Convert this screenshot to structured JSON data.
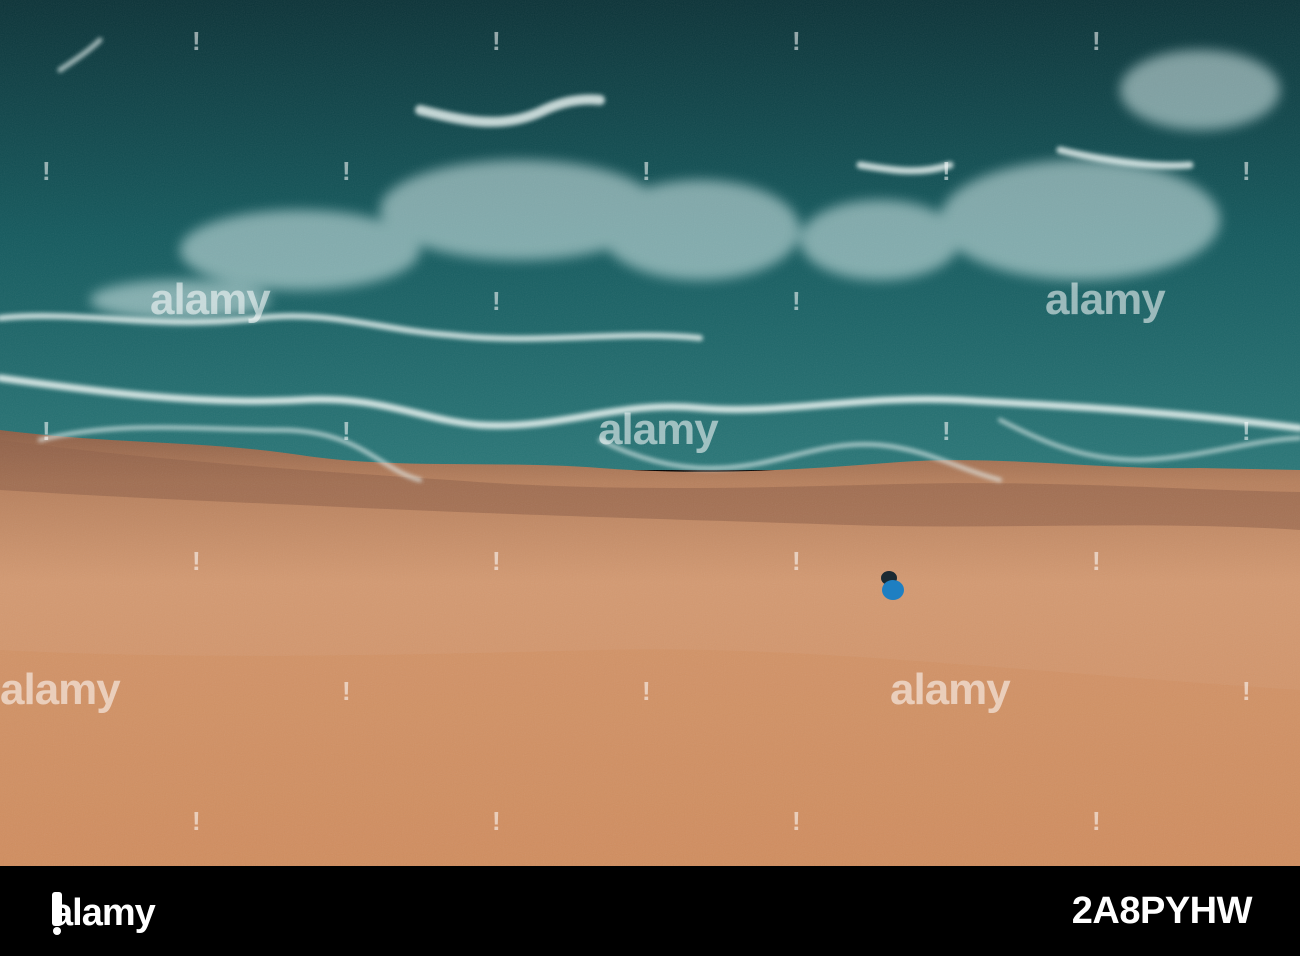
{
  "watermark": {
    "brand": "alamy",
    "mark": "!"
  },
  "footer": {
    "logo_text": "alamy",
    "image_id": "2A8PYHW"
  },
  "colors": {
    "deep_sea": "#0f3e45",
    "sea": "#1e6f73",
    "foam": "#e6f2f0",
    "wet_sand": "#9c6a4f",
    "dry_sand": "#d79a71",
    "umbrella": "#1e7fc2",
    "footer_bg": "#000000"
  },
  "icons": {
    "logo": "alamy-logo-icon",
    "umbrella": "beach-umbrella-icon"
  }
}
